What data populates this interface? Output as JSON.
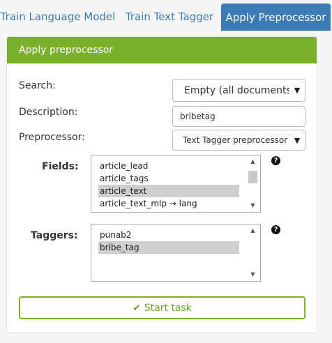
{
  "tabs": [
    {
      "label": "Train Language Model"
    },
    {
      "label": "Train Text Tagger"
    },
    {
      "label": "Apply Preprocessor"
    }
  ],
  "panel": {
    "title": "Apply preprocessor",
    "search": {
      "label": "Search:",
      "value": "Empty (all documents)"
    },
    "description": {
      "label": "Description:",
      "value": "bribetag"
    },
    "preprocessor": {
      "label": "Preprocessor:",
      "value": "Text Tagger preprocessor"
    },
    "fields": {
      "label": "Fields:",
      "items": [
        "article_lead",
        "article_tags",
        "article_text",
        "article_text_mlp → lang"
      ],
      "selected": [
        "article_text"
      ]
    },
    "taggers": {
      "label": "Taggers:",
      "items": [
        "punab2",
        "bribe_tag"
      ],
      "selected": [
        "bribe_tag"
      ]
    },
    "start_button": {
      "label": "Start task"
    }
  },
  "colors": {
    "accent_green": "#79b02c",
    "tab_blue": "#3a7bb8"
  }
}
